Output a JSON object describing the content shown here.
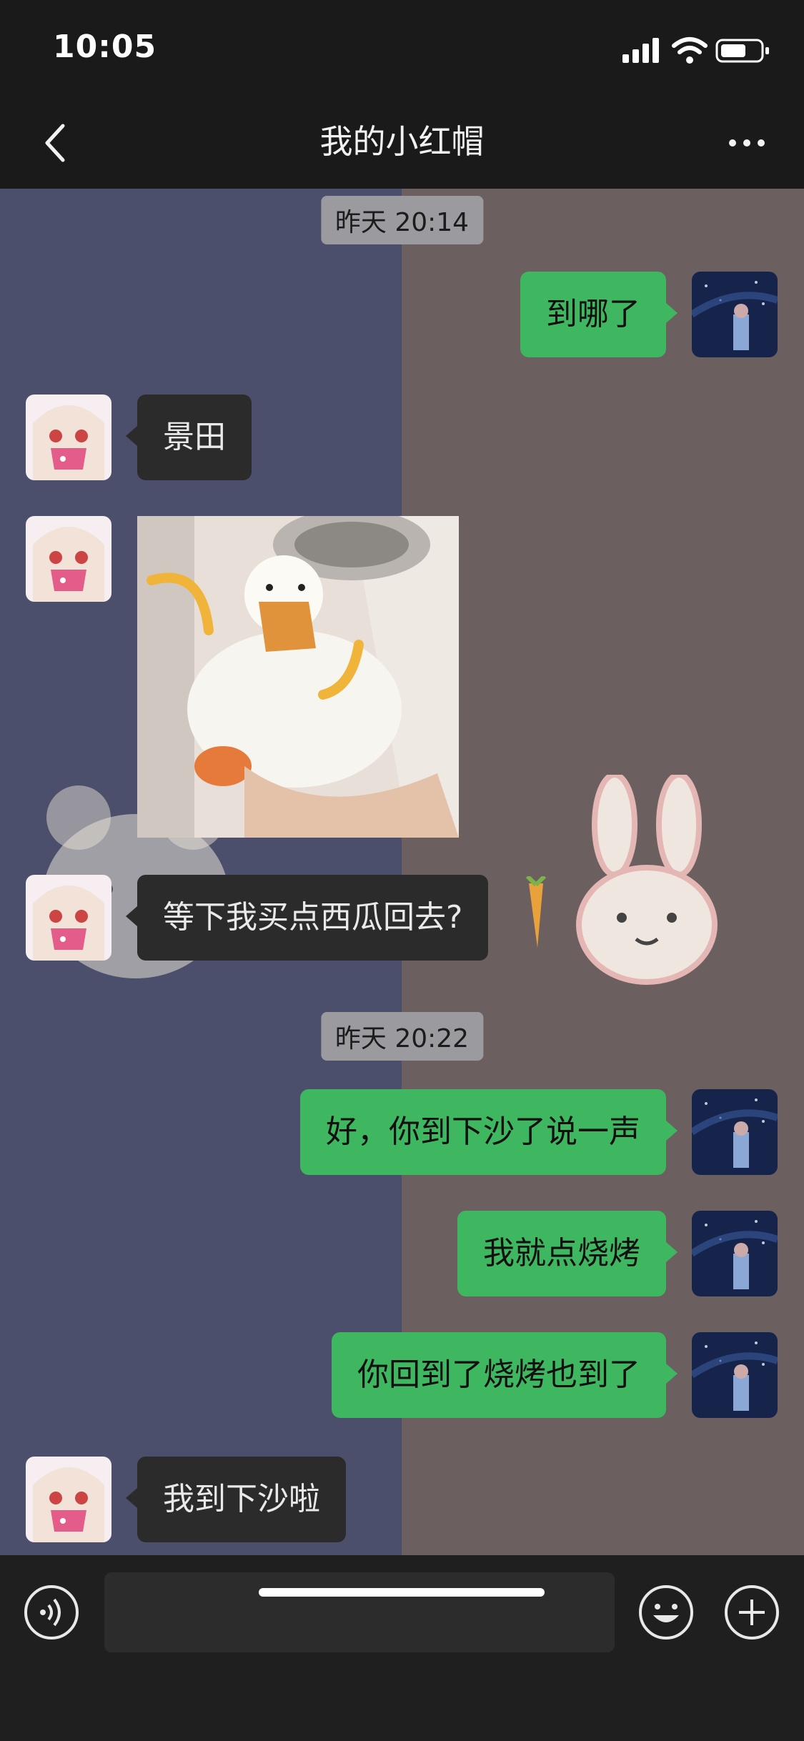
{
  "status_bar": {
    "time": "10:05"
  },
  "nav": {
    "title": "我的小红帽"
  },
  "messages": {
    "ts1": "昨天 20:14",
    "m1": "到哪了",
    "m2": "景田",
    "m4": "等下我买点西瓜回去?",
    "ts2": "昨天 20:22",
    "m5": "好，你到下沙了说一声",
    "m6": "我就点烧烤",
    "m7": "你回到了烧烤也到了",
    "m8": "我到下沙啦"
  },
  "icons": {
    "back": "chevron-left-icon",
    "more": "more-horizontal-icon",
    "voice": "voice-icon",
    "emoji": "emoji-icon",
    "add": "plus-icon"
  },
  "colors": {
    "outgoing_bubble": "#3fb760",
    "incoming_bubble": "#2b2b2b",
    "chat_bg_left": "#4b4f6b",
    "chat_bg_right": "#6b605f"
  }
}
